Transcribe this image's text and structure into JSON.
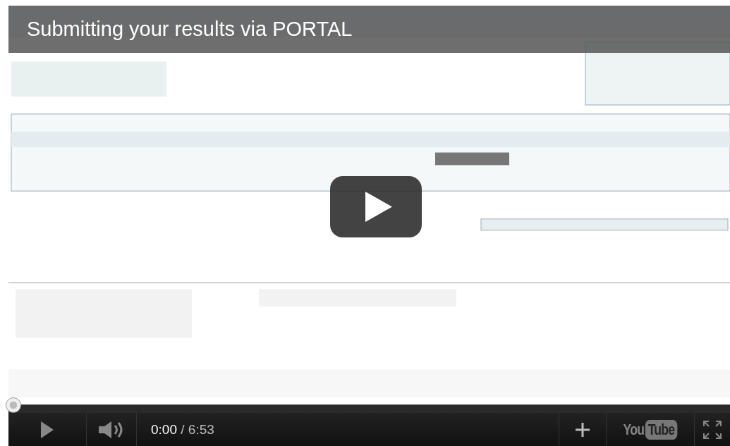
{
  "video": {
    "title": "Submitting your results via PORTAL"
  },
  "player": {
    "progress": {
      "level": 0
    },
    "current_time": "0:00",
    "duration": "/ 6:53",
    "logo": {
      "part_1": "You",
      "part_2": "Tube"
    }
  }
}
